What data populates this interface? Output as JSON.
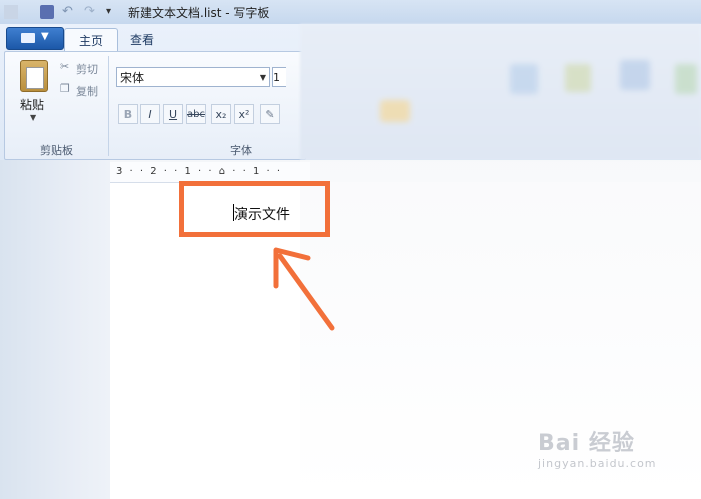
{
  "window": {
    "title": "新建文本文档.list - 写字板"
  },
  "ribbon": {
    "tabs": [
      {
        "label": "主页",
        "active": true
      },
      {
        "label": "查看",
        "active": false
      }
    ],
    "clipboard": {
      "paste_label": "粘贴",
      "cut_label": "剪切",
      "copy_label": "复制",
      "group_label": "剪贴板"
    },
    "font": {
      "family_value": "宋体",
      "size_value": "1",
      "group_label": "字体",
      "buttons": {
        "bold": "B",
        "italic": "I",
        "underline": "U",
        "strike": "abc",
        "subscript": "x₂",
        "superscript": "x²"
      }
    }
  },
  "ruler": {
    "ticks": "3 · · 2 · · 1 · · ⌂ · · 1 · ·"
  },
  "document": {
    "text": "演示文件"
  },
  "watermark": {
    "main": "Bai 经验",
    "sub": "jingyan.baidu.com"
  },
  "colors": {
    "highlight": "#f2703a",
    "accent": "#1c58a8"
  }
}
